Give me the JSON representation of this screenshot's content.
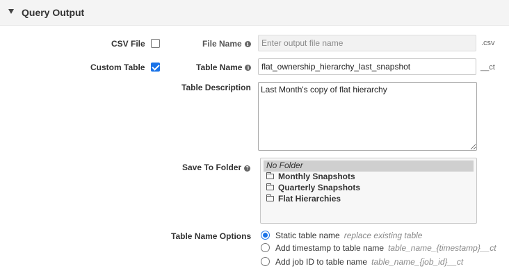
{
  "section": {
    "title": "Query Output"
  },
  "csv_file": {
    "label": "CSV File",
    "checked": false
  },
  "file_name": {
    "label": "File Name",
    "placeholder": "Enter output file name",
    "value": "",
    "suffix": ".csv"
  },
  "custom_table": {
    "label": "Custom Table",
    "checked": true
  },
  "table_name": {
    "label": "Table Name",
    "value": "flat_ownership_hierarchy_last_snapshot",
    "suffix": "__ct"
  },
  "table_description": {
    "label": "Table Description",
    "value": "Last Month's copy of flat hierarchy"
  },
  "save_to_folder": {
    "label": "Save To Folder",
    "options": [
      {
        "label": "No Folder",
        "selected": true,
        "icon": ""
      },
      {
        "label": "Monthly Snapshots",
        "selected": false,
        "icon": "folder-icon"
      },
      {
        "label": "Quarterly Snapshots",
        "selected": false,
        "icon": "folder-icon"
      },
      {
        "label": "Flat Hierarchies",
        "selected": false,
        "icon": "folder-icon"
      }
    ]
  },
  "table_name_options": {
    "label": "Table Name Options",
    "options": [
      {
        "label": "Static table name",
        "hint": "replace existing table",
        "checked": true
      },
      {
        "label": "Add timestamp to table name",
        "hint": "table_name_{timestamp}__ct",
        "checked": false
      },
      {
        "label": "Add job ID to table name",
        "hint": "table_name_{job_id}__ct",
        "checked": false
      }
    ]
  },
  "colors": {
    "accent": "#1a73e8",
    "header_bg": "#f4f4f4"
  }
}
